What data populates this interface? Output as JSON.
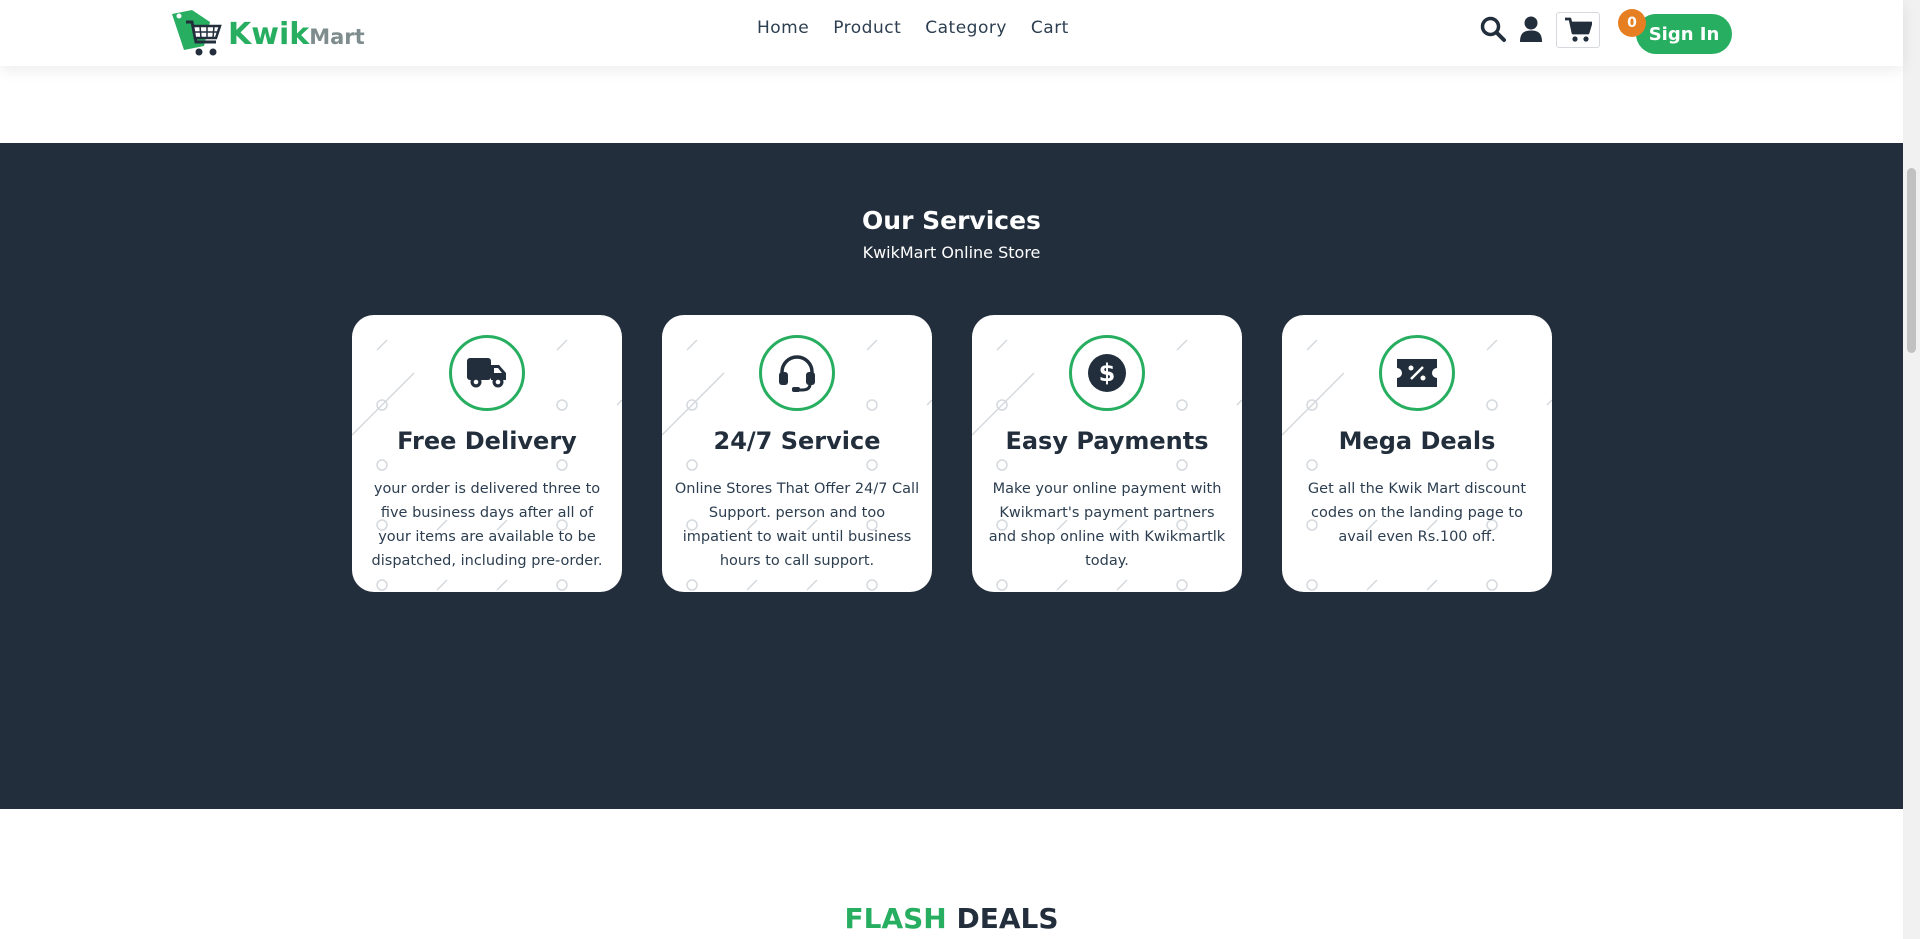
{
  "header": {
    "logo": {
      "kwik": "Kwik",
      "mart": "Mart"
    },
    "nav": [
      "Home",
      "Product",
      "Category",
      "Cart"
    ],
    "cart_count": "0",
    "signin_label": "Sign In"
  },
  "services": {
    "title": "Our Services",
    "subtitle": "KwikMart Online Store",
    "cards": [
      {
        "icon": "truck-icon",
        "title": "Free Delivery",
        "desc": "your order is delivered three to five business days after all of your items are available to be dispatched, including pre-order."
      },
      {
        "icon": "headset-icon",
        "title": "24/7 Service",
        "desc": "Online Stores That Offer 24/7 Call Support. person and too impatient to wait until business hours to call support."
      },
      {
        "icon": "dollar-icon",
        "title": "Easy Payments",
        "desc": "Make your online payment with Kwikmart's payment partners and shop online with Kwikmartlk today."
      },
      {
        "icon": "ticket-percent-icon",
        "title": "Mega Deals",
        "desc": "Get all the Kwik Mart discount codes on the landing page to avail even Rs.100 off."
      }
    ]
  },
  "flash": {
    "word1": "FLASH",
    "word2": "DEALS"
  },
  "colors": {
    "accent": "#27ae60",
    "dark": "#222e3c",
    "badge": "#e67e22"
  }
}
